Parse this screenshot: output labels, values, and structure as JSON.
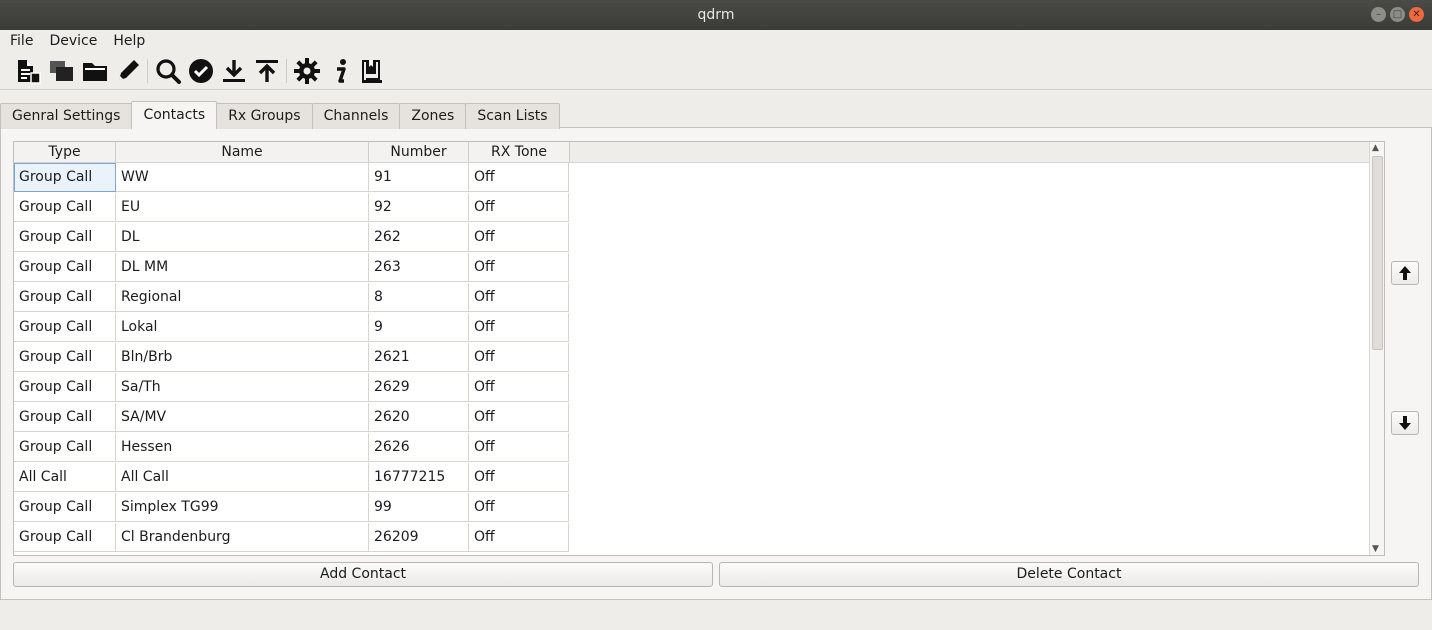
{
  "window": {
    "title": "qdrm"
  },
  "menubar": {
    "items": [
      "File",
      "Device",
      "Help"
    ]
  },
  "toolbar": {
    "icons": [
      "new-document-icon",
      "copy-windows-icon",
      "open-folder-icon",
      "edit-pencil-icon",
      "search-icon",
      "verify-check-icon",
      "download-icon",
      "upload-icon",
      "settings-gear-icon",
      "info-icon",
      "codeplug-book-icon"
    ]
  },
  "tabs": [
    {
      "label": "Genral Settings",
      "active": false
    },
    {
      "label": "Contacts",
      "active": true
    },
    {
      "label": "Rx Groups",
      "active": false
    },
    {
      "label": "Channels",
      "active": false
    },
    {
      "label": "Zones",
      "active": false
    },
    {
      "label": "Scan Lists",
      "active": false
    }
  ],
  "contacts": {
    "columns": [
      "Type",
      "Name",
      "Number",
      "RX Tone"
    ],
    "rows": [
      [
        "Group Call",
        "WW",
        "91",
        "Off"
      ],
      [
        "Group Call",
        "EU",
        "92",
        "Off"
      ],
      [
        "Group Call",
        "DL",
        "262",
        "Off"
      ],
      [
        "Group Call",
        "DL MM",
        "263",
        "Off"
      ],
      [
        "Group Call",
        "Regional",
        "8",
        "Off"
      ],
      [
        "Group Call",
        "Lokal",
        "9",
        "Off"
      ],
      [
        "Group Call",
        "Bln/Brb",
        "2621",
        "Off"
      ],
      [
        "Group Call",
        "Sa/Th",
        "2629",
        "Off"
      ],
      [
        "Group Call",
        "SA/MV",
        "2620",
        "Off"
      ],
      [
        "Group Call",
        "Hessen",
        "2626",
        "Off"
      ],
      [
        "All Call",
        "All Call",
        "16777215",
        "Off"
      ],
      [
        "Group Call",
        "Simplex TG99",
        "99",
        "Off"
      ],
      [
        "Group Call",
        "Cl Brandenburg",
        "26209",
        "Off"
      ]
    ]
  },
  "buttons": {
    "add": "Add Contact",
    "delete": "Delete Contact"
  },
  "colors": {
    "titlebar": "#3b3b37",
    "close": "#ed6a3f",
    "selection": "#7aa7d8"
  }
}
